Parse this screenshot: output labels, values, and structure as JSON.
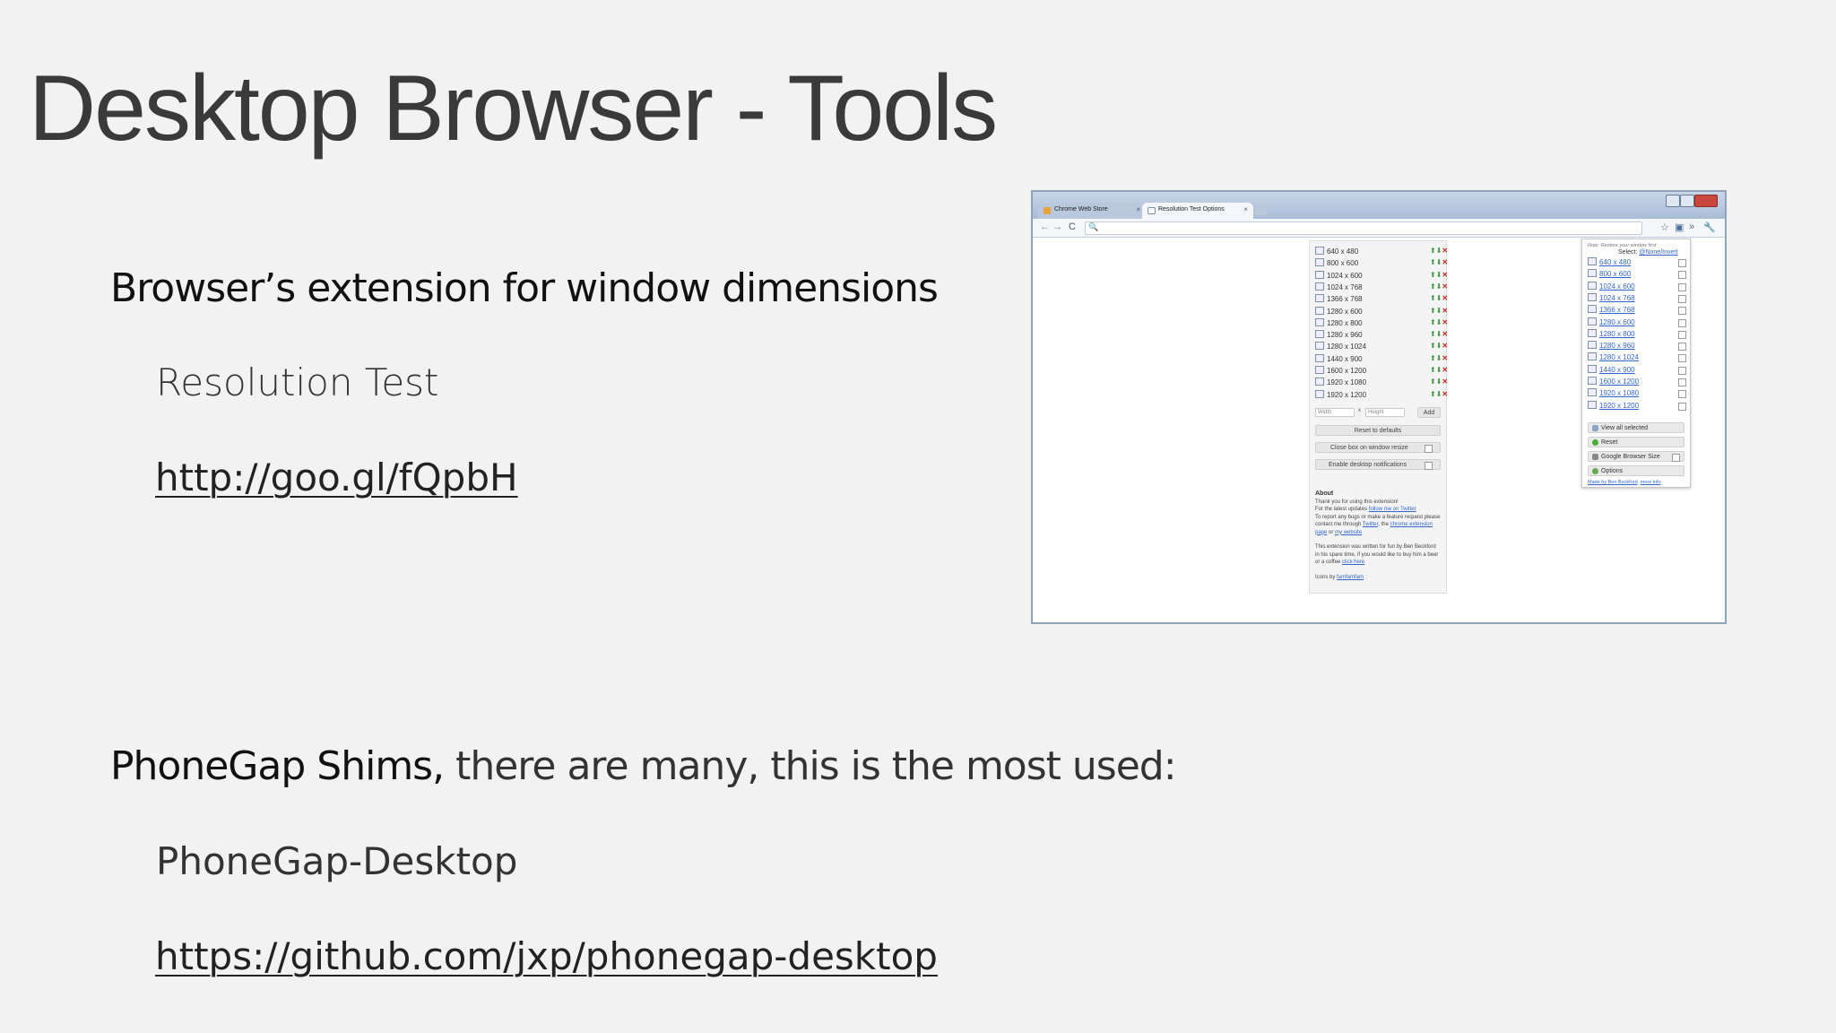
{
  "slide": {
    "title": "Desktop Browser - Tools",
    "section1": {
      "heading": "Browser’s extension for window dimensions",
      "name": "Resolution Test",
      "link": "http://goo.gl/fQpbH"
    },
    "section2": {
      "heading_bold": "PhoneGap Shims,",
      "heading_rest": " there are many, this is the most used:",
      "name": "PhoneGap-Desktop",
      "link": "https://github.com/jxp/phonegap-desktop"
    }
  },
  "screenshot": {
    "tabs": [
      {
        "label": "Chrome Web Store",
        "icon": "chrome-store-icon",
        "close": "×"
      },
      {
        "label": "Resolution Test Options",
        "icon": "page-icon",
        "close": "×"
      }
    ],
    "nav": {
      "back": "←",
      "forward": "→",
      "reload": "C",
      "search": "🔍"
    },
    "toolbar_right": {
      "star": "☆",
      "ext": "▣",
      "more": "»",
      "wrench": "🔧"
    },
    "resolutions": [
      "640 x 480",
      "800 x 600",
      "1024 x 600",
      "1024 x 768",
      "1366 x 768",
      "1280 x 600",
      "1280 x 800",
      "1280 x 960",
      "1280 x 1024",
      "1440 x 900",
      "1600 x 1200",
      "1920 x 1080",
      "1920 x 1200"
    ],
    "row_actions": {
      "up": "⬆",
      "down": "⬇",
      "remove": "✕"
    },
    "custom": {
      "width_placeholder": "Width",
      "times": "x",
      "height_placeholder": "Height",
      "add": "Add"
    },
    "options": {
      "reset": "Reset to defaults",
      "close_box": "Close box on window resize",
      "notifications": "Enable desktop notifications"
    },
    "about": {
      "heading": "About",
      "p1_a": "Thank you for using this extension!",
      "p1_b": "For the latest updates ",
      "p1_b_link": "follow me on Twitter",
      "p1_c": "To report any bugs or make a feature request please contact me through ",
      "p1_c_link1": "Twitter",
      "p1_c_mid": ", the ",
      "p1_c_link2": "chrome extension page",
      "p1_c_or": " or ",
      "p1_c_link3": "my website",
      "p2": "This extension was written for fun by Ben Beckford in his spare time, if you would like to buy him a beer or a coffee ",
      "p2_link": "click here",
      "p3": "Icons by ",
      "p3_link": "famfamfam"
    },
    "popup": {
      "note": "Note: Restore your window first",
      "select_label": "Select:",
      "select_link": "@None/Invert",
      "resolutions": [
        "640 x 480",
        "800 x 600",
        "1024 x 600",
        "1024 x 768",
        "1366 x 768",
        "1280 x 600",
        "1280 x 800",
        "1280 x 960",
        "1280 x 1024",
        "1440 x 900",
        "1600 x 1200",
        "1920 x 1080",
        "1920 x 1200"
      ],
      "view_all": "View all selected",
      "reset": "Reset",
      "google_size": "Google Browser Size",
      "options": "Options",
      "made_by": "Made by Ben Beckford",
      "more_info": "more info"
    }
  }
}
